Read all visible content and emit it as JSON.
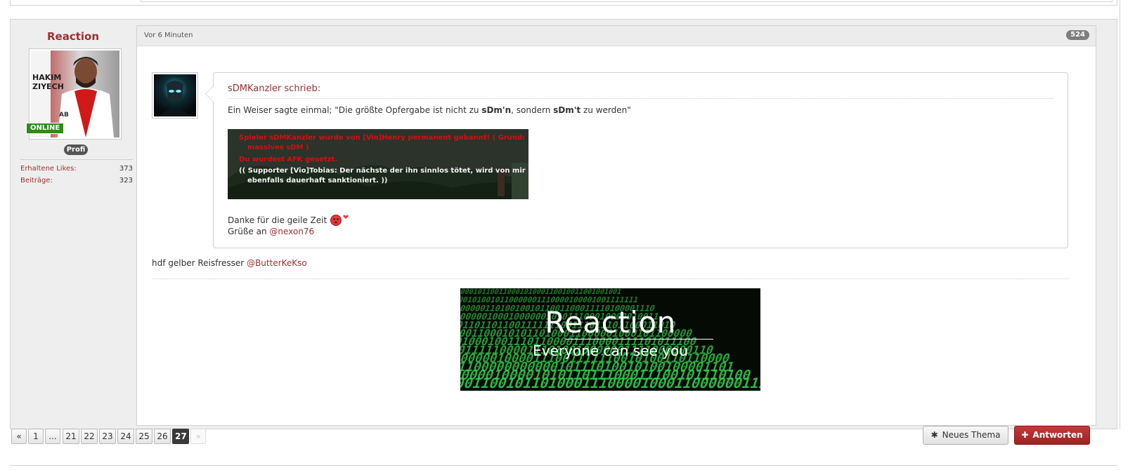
{
  "post": {
    "author": {
      "username": "Reaction",
      "status_badge": "ONLINE",
      "rank": "Profi",
      "stats": [
        {
          "label": "Erhaltene Likes",
          "value": "373"
        },
        {
          "label": "Beiträge",
          "value": "323"
        }
      ]
    },
    "time": "Vor 6 Minuten",
    "post_number": "524",
    "quote": {
      "author_line": "sDMKanzler schrieb:",
      "text1_pre": "Ein Weiser sagte einmal; \"Die größte Opfergabe ist nicht zu ",
      "text1_bold1": "sDm'n",
      "text1_mid": ", sondern ",
      "text1_bold2": "sDm't",
      "text1_post": " zu werden\"",
      "image_lines": [
        "Spieler sDMKanzler wurde von [Vio]Henry permanent gebannt! ( Grund:",
        "massives sDM )",
        "Du wurdest AFK gesetzt.",
        "(( Supporter [Vio]Tobias: Der nächste der ihn sinnlos tötet, wird von mir",
        "ebenfalls dauerhaft sanktioniert. ))"
      ],
      "text2": "Danke für die geile Zeit",
      "text3_pre": "Grüße an ",
      "text3_mention": "@nexon76"
    },
    "body_text": "hdf gelber Reisfresser ",
    "body_mention": "@ButterKeKso",
    "signature": {
      "title": "Reaction",
      "subtitle": "Everyone can see you"
    }
  },
  "pagination": {
    "prev": "«",
    "pages": [
      "1",
      "...",
      "21",
      "22",
      "23",
      "24",
      "25",
      "26",
      "27"
    ],
    "current": "27",
    "next": "»"
  },
  "actions": {
    "new_thread_icon": "✱",
    "new_thread": "Neues Thema",
    "reply_icon": "✚",
    "reply": "Antworten"
  },
  "colors": {
    "accent": "#a02f2f",
    "online": "#2e8b1e",
    "reply_button": "#b02c2c"
  }
}
